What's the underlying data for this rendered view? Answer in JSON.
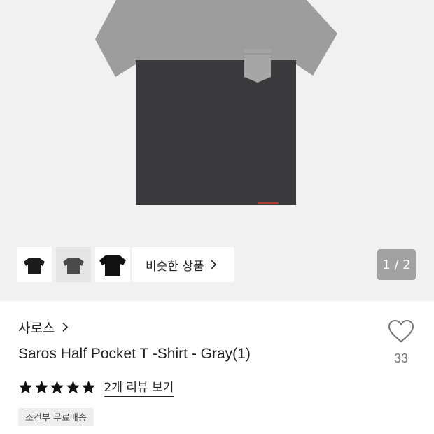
{
  "gallery": {
    "thumbnails": [
      {
        "icon": "tshirt-black-icon"
      },
      {
        "icon": "tshirt-charcoal-icon"
      },
      {
        "icon": "tshirt-black-large-icon"
      }
    ],
    "similar_label": "비슷한 상품",
    "pager": "1 / 2"
  },
  "product": {
    "brand": "사로스",
    "title": "Saros Half Pocket T -Shirt - Gray(1)",
    "stars": 5,
    "review_link": "2개 리뷰 보기",
    "shipping_badge": "조건부 무료배송",
    "like_count": "33"
  },
  "colors": {
    "gray_panel": "#9d9d9d",
    "dark_body": "#3a3a3d",
    "accent_label": "#b03a3a"
  }
}
